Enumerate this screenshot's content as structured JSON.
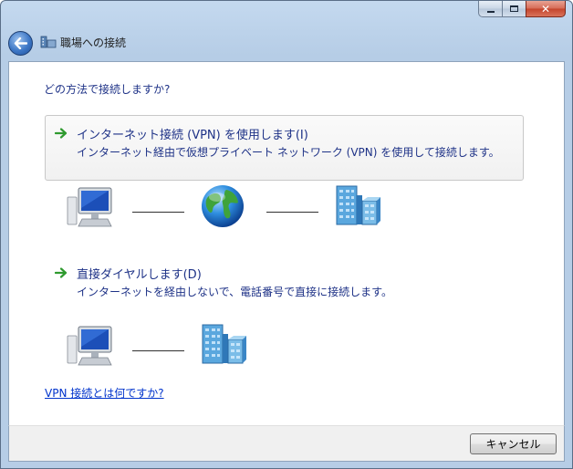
{
  "window": {
    "title": "職場への接続",
    "minimize_icon": "minimize-icon",
    "maximize_icon": "maximize-icon",
    "close_glyph": "✕"
  },
  "content": {
    "question": "どの方法で接続しますか?",
    "options": [
      {
        "title": "インターネット接続 (VPN) を使用します(I)",
        "description": "インターネット経由で仮想プライベート ネットワーク (VPN) を使用して接続します。",
        "diagram": [
          "computer-icon",
          "globe-icon",
          "corporate-network-icon"
        ]
      },
      {
        "title": "直接ダイヤルします(D)",
        "description": "インターネットを経由しないで、電話番号で直接に接続します。",
        "diagram": [
          "computer-icon",
          "corporate-network-icon"
        ]
      }
    ],
    "help_link": "VPN 接続とは何ですか?"
  },
  "footer": {
    "cancel_label": "キャンセル"
  },
  "colors": {
    "instruction_text": "#1e3287",
    "link": "#0033cc",
    "arrow_green": "#2f9a2f"
  }
}
